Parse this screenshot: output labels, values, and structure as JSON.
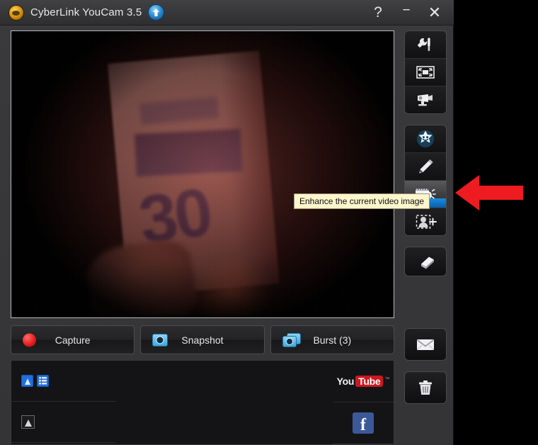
{
  "window": {
    "title": "CyberLink YouCam 3.5",
    "logo_icon": "youcam-logo-icon",
    "upgrade_icon": "upgrade-arrow-icon",
    "controls": {
      "help": "?",
      "minimize": "−",
      "close": "✕"
    }
  },
  "preview": {
    "name": "video-preview",
    "description": "Dark low-light webcam image of a hand holding a package labeled 30"
  },
  "capture_bar": {
    "buttons": [
      {
        "label": "Capture",
        "icon": "record-dot-icon",
        "name": "capture-button"
      },
      {
        "label": "Snapshot",
        "icon": "camera-icon",
        "name": "snapshot-button"
      },
      {
        "label": "Burst (3)",
        "icon": "burst-camera-icon",
        "name": "burst-button"
      }
    ]
  },
  "gallery": {
    "filters": [
      {
        "icon": "photo-filter-icon",
        "name": "filter-photos",
        "active": true
      },
      {
        "icon": "video-filter-icon",
        "name": "filter-videos",
        "active": true
      }
    ],
    "thumbnail_icon": "photo-thumbnail-icon",
    "share": [
      {
        "name": "youtube-share-button",
        "you": "You",
        "tube": "Tube",
        "tm": "™"
      },
      {
        "name": "facebook-share-button",
        "letter": "f"
      }
    ]
  },
  "toolbar": {
    "groups": [
      {
        "name": "settings-group",
        "buttons": [
          {
            "icon": "settings-wrench-icon",
            "name": "settings-button"
          },
          {
            "icon": "fullscreen-icon",
            "name": "fullscreen-button"
          },
          {
            "icon": "webcam-icon",
            "name": "webcam-button"
          }
        ]
      },
      {
        "name": "effects-group",
        "buttons": [
          {
            "icon": "avatar-star-face-icon",
            "name": "avatar-effects-button"
          },
          {
            "icon": "pencil-icon",
            "name": "draw-button"
          },
          {
            "icon": "enhance-icon",
            "name": "enhance-button",
            "active": true
          },
          {
            "icon": "face-add-icon",
            "name": "face-login-button"
          }
        ]
      }
    ],
    "eraser": {
      "icon": "eraser-icon",
      "name": "eraser-button"
    },
    "bottom": [
      {
        "icon": "envelope-icon",
        "name": "email-button"
      },
      {
        "icon": "trash-icon",
        "name": "delete-button"
      }
    ]
  },
  "tooltip": {
    "text": "Enhance the current video image"
  },
  "annotation": {
    "arrow": {
      "name": "red-arrow-annotation",
      "color": "#ee1b20",
      "direction": "left"
    }
  },
  "preview_text": {
    "number": "30"
  }
}
